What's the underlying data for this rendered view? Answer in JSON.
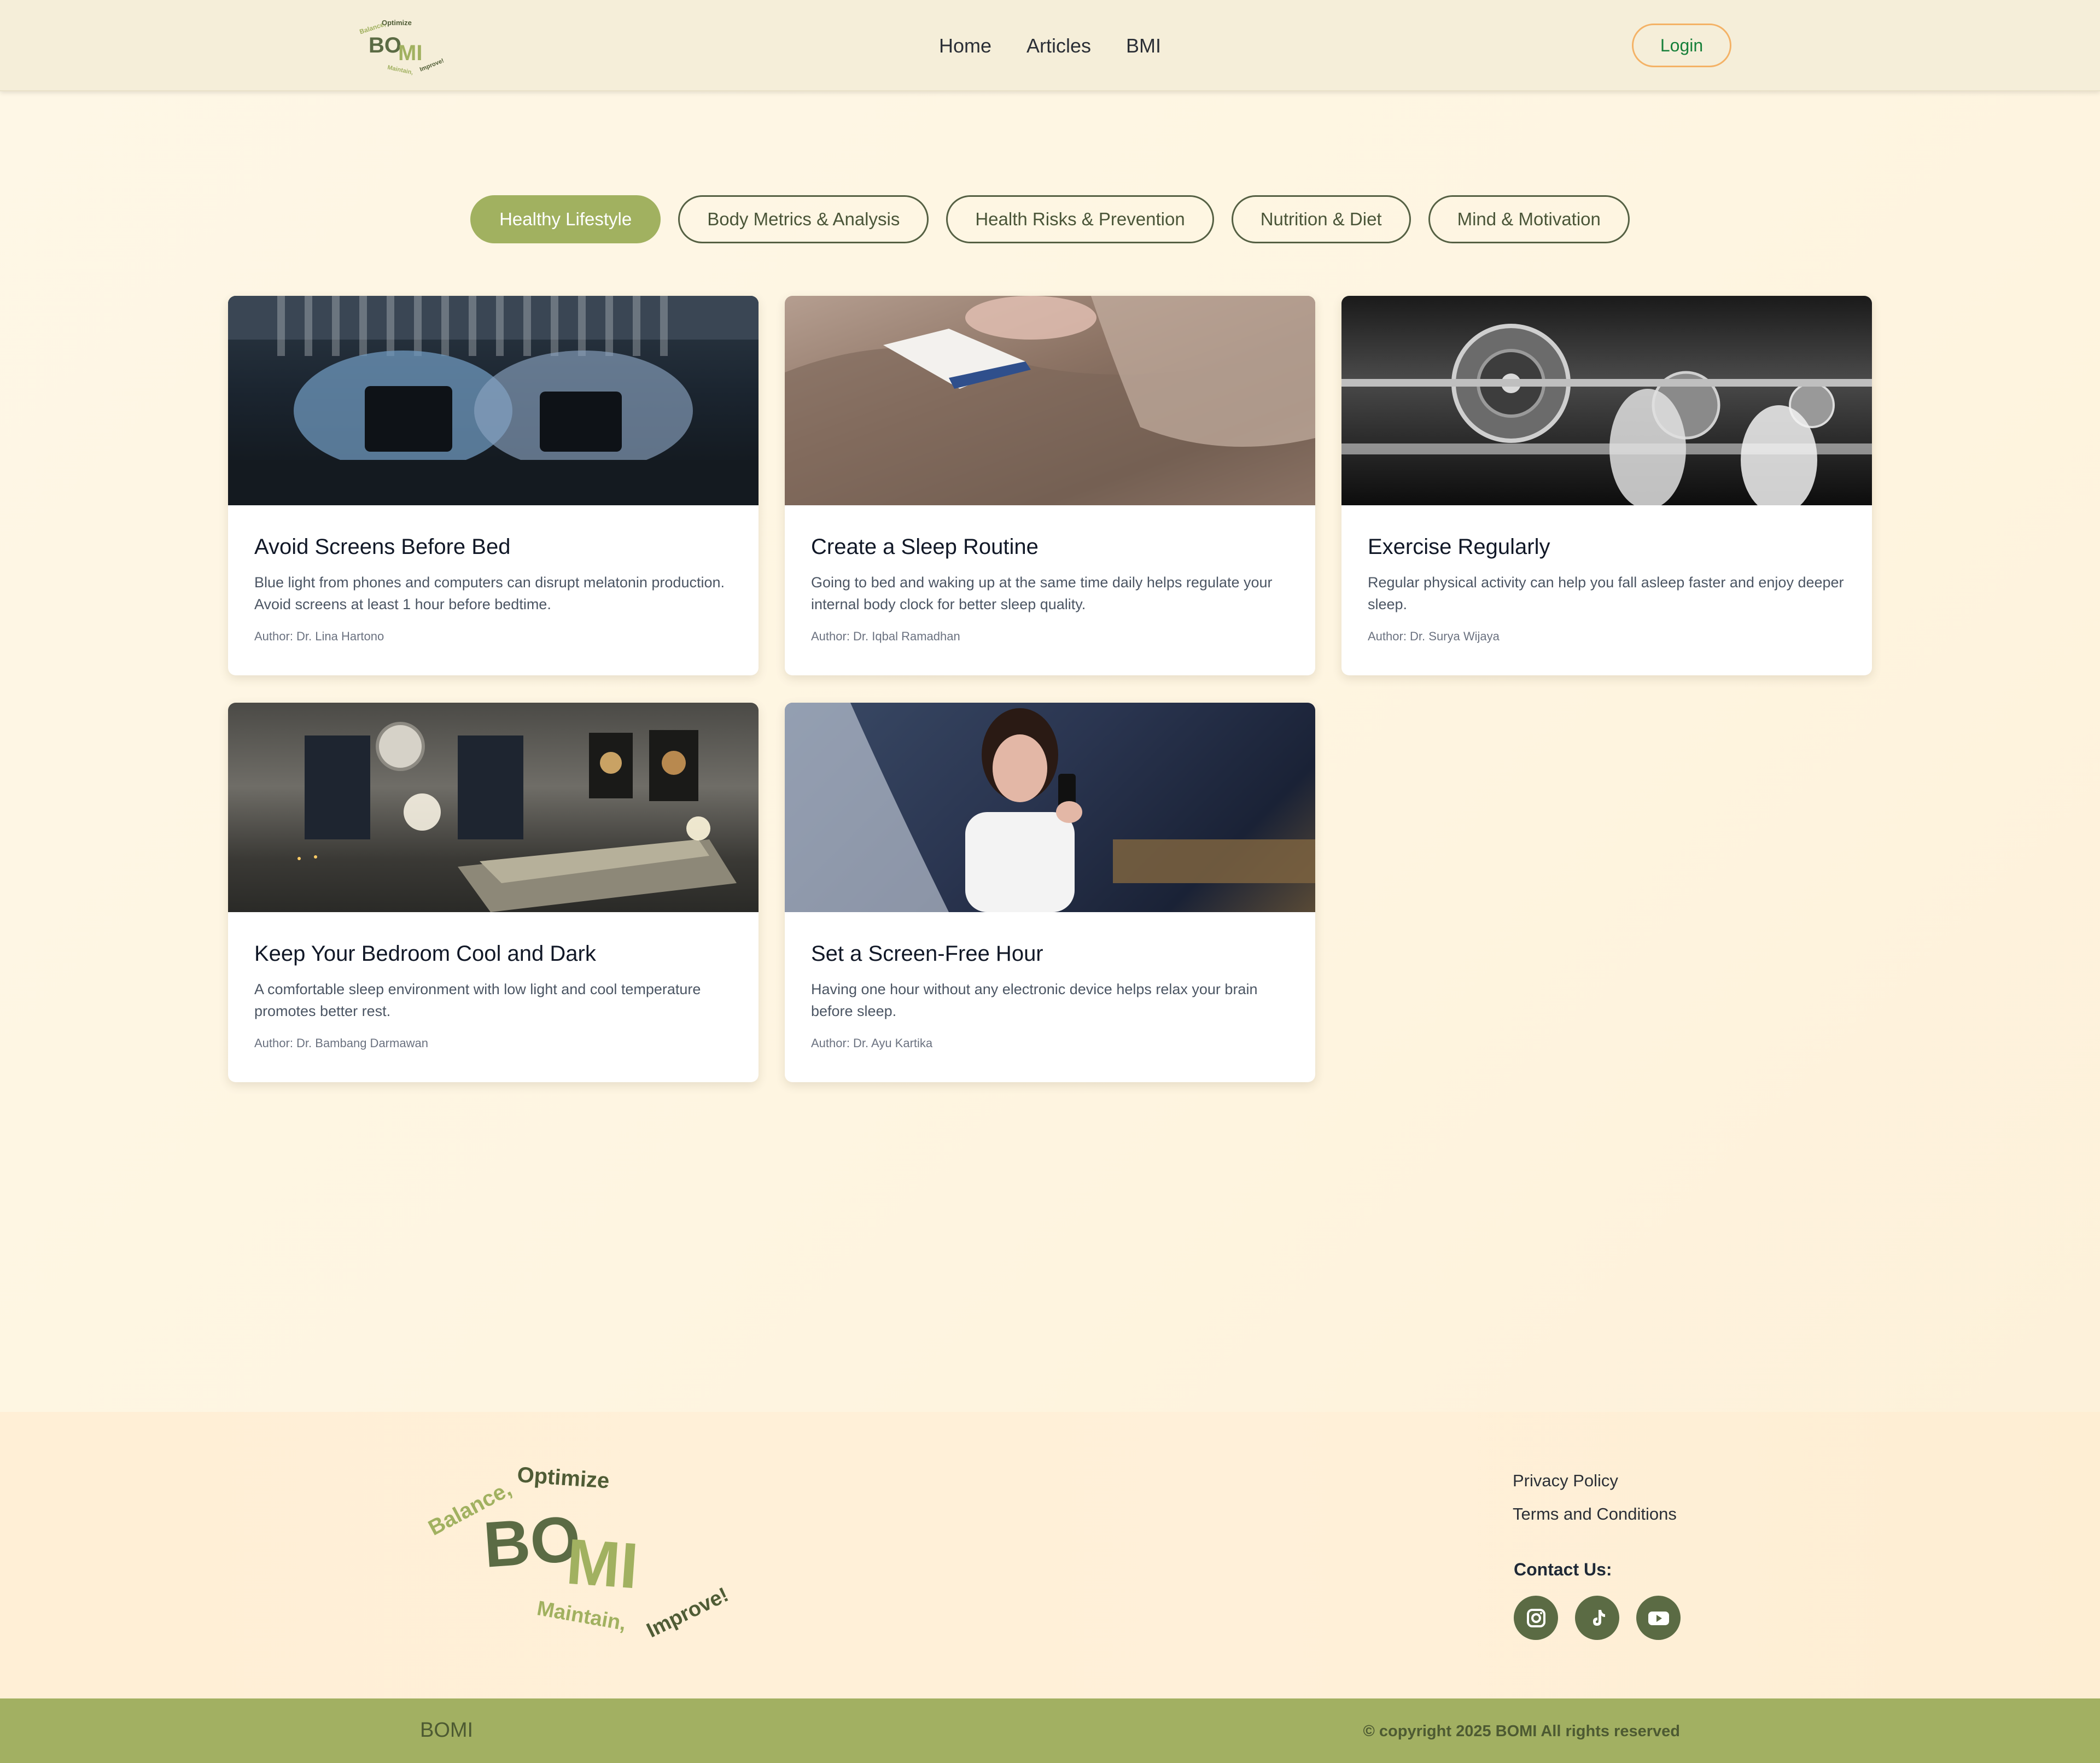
{
  "brand": {
    "name": "BOMI",
    "tagline_top": "Balance, Optimize",
    "tagline_bottom": "Maintain, Improve!"
  },
  "nav": {
    "items": [
      {
        "label": "Home"
      },
      {
        "label": "Articles"
      },
      {
        "label": "BMI"
      }
    ],
    "login_label": "Login"
  },
  "categories": [
    {
      "label": "Healthy Lifestyle",
      "active": true
    },
    {
      "label": "Body Metrics & Analysis",
      "active": false
    },
    {
      "label": "Health Risks & Prevention",
      "active": false
    },
    {
      "label": "Nutrition & Diet",
      "active": false
    },
    {
      "label": "Mind & Motivation",
      "active": false
    }
  ],
  "articles": [
    {
      "title": "Avoid Screens Before Bed",
      "description": "Blue light from phones and computers can disrupt melatonin production. Avoid screens at least 1 hour before bedtime.",
      "author": "Author: Dr. Lina Hartono",
      "image": "people-using-tablets-in-bed"
    },
    {
      "title": "Create a Sleep Routine",
      "description": "Going to bed and waking up at the same time daily helps regulate your internal body clock for better sleep quality.",
      "author": "Author: Dr. Iqbal Ramadhan",
      "image": "reading-book-in-bed"
    },
    {
      "title": "Exercise Regularly",
      "description": "Regular physical activity can help you fall asleep faster and enjoy deeper sleep.",
      "author": "Author: Dr. Surya Wijaya",
      "image": "people-lifting-barbells"
    },
    {
      "title": "Keep Your Bedroom Cool and Dark",
      "description": "A comfortable sleep environment with low light and cool temperature promotes better rest.",
      "author": "Author: Dr. Bambang Darmawan",
      "image": "dim-bedroom"
    },
    {
      "title": "Set a Screen-Free Hour",
      "description": "Having one hour without any electronic device helps relax your brain before sleep.",
      "author": "Author: Dr. Ayu Kartika",
      "image": "tired-woman-with-phone"
    }
  ],
  "footer": {
    "links": [
      {
        "label": "Privacy Policy"
      },
      {
        "label": "Terms and Conditions"
      }
    ],
    "contact_title": "Contact Us:",
    "socials": [
      "instagram-icon",
      "tiktok-icon",
      "youtube-icon"
    ],
    "bottom_brand": "BOMI",
    "copyright": "© copyright 2025 BOMI All rights reserved"
  },
  "colors": {
    "accent_green": "#a1b160",
    "dark_green": "#5b6b44",
    "login_border": "#f4b266",
    "login_text": "#17803a",
    "header_bg": "#f5eed9"
  }
}
